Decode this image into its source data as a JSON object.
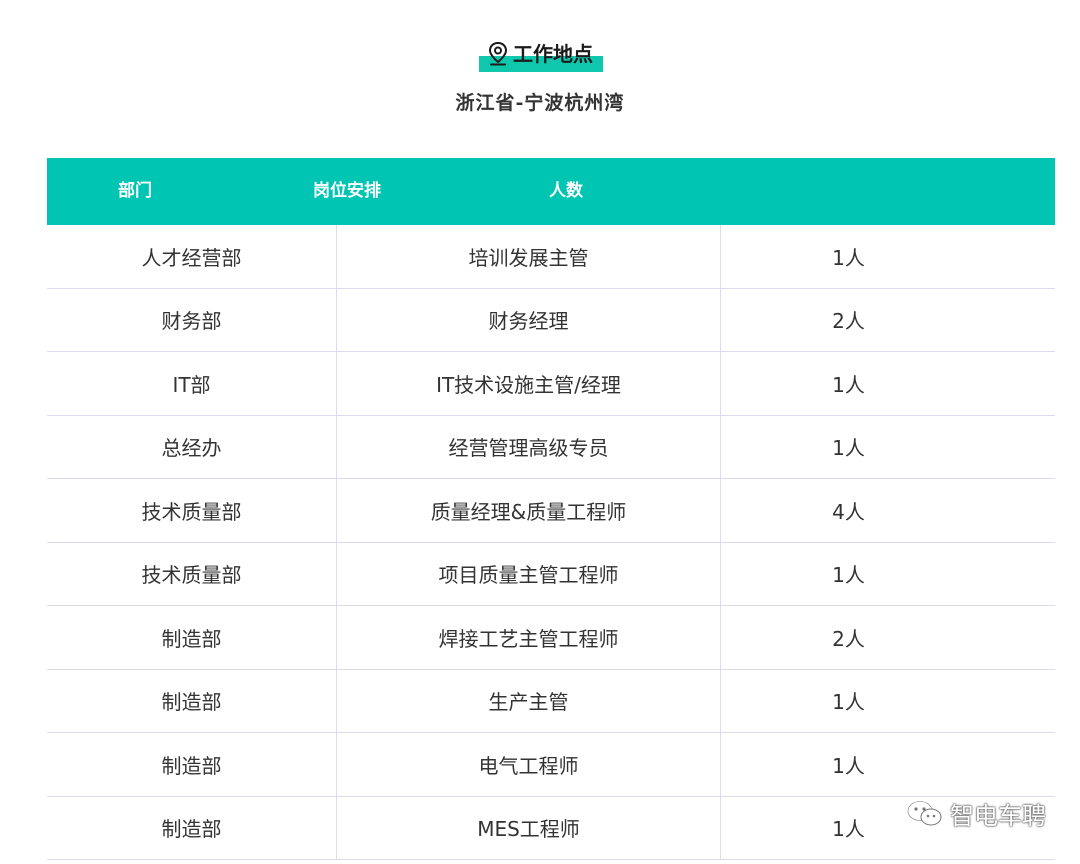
{
  "section": {
    "title": "工作地点",
    "location": "浙江省-宁波杭州湾",
    "icon": "location-pin-icon",
    "accent_color": "#0fc7ac"
  },
  "table": {
    "header_color": "#00c5b2",
    "columns": [
      "部门",
      "岗位安排",
      "人数"
    ],
    "rows": [
      {
        "dept": "人才经营部",
        "position": "培训发展主管",
        "count": "1人"
      },
      {
        "dept": "财务部",
        "position": "财务经理",
        "count": "2人"
      },
      {
        "dept": "IT部",
        "position": "IT技术设施主管/经理",
        "count": "1人"
      },
      {
        "dept": "总经办",
        "position": "经营管理高级专员",
        "count": "1人"
      },
      {
        "dept": "技术质量部",
        "position": "质量经理&质量工程师",
        "count": "4人"
      },
      {
        "dept": "技术质量部",
        "position": "项目质量主管工程师",
        "count": "1人"
      },
      {
        "dept": "制造部",
        "position": "焊接工艺主管工程师",
        "count": "2人"
      },
      {
        "dept": "制造部",
        "position": "生产主管",
        "count": "1人"
      },
      {
        "dept": "制造部",
        "position": "电气工程师",
        "count": "1人"
      },
      {
        "dept": "制造部",
        "position": "MES工程师",
        "count": "1人"
      }
    ]
  },
  "watermark": {
    "text": "智电车聘",
    "icon": "wechat-icon"
  }
}
